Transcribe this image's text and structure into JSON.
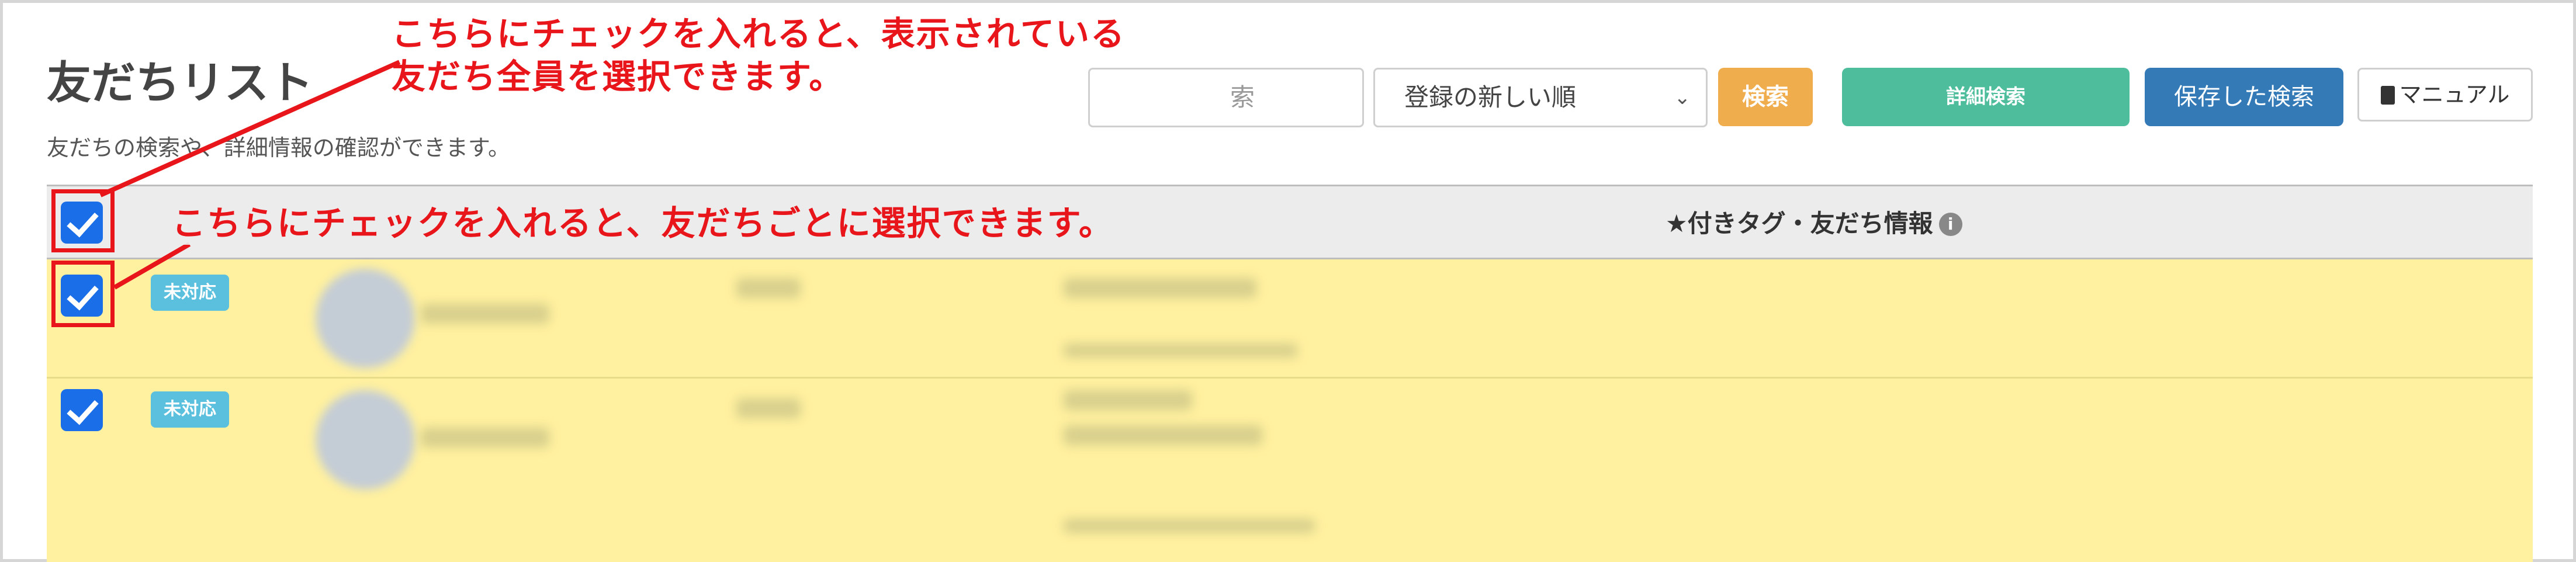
{
  "page": {
    "title": "友だちリスト",
    "description": "友だちの検索や、詳細情報の確認ができます。"
  },
  "toolbar": {
    "search_placeholder": "索",
    "sort_selected": "登録の新しい順",
    "search_label": "検索",
    "detail_search_label": "詳細検索",
    "saved_search_label": "保存した検索",
    "manual_label": "マニュアル"
  },
  "table": {
    "header": "★付きタグ・友だち情報",
    "rows": [
      {
        "checked": true,
        "status": "未対応"
      },
      {
        "checked": true,
        "status": "未対応"
      }
    ]
  },
  "annotations": {
    "select_all_line1": "こちらにチェックを入れると、表示されている",
    "select_all_line2": "友だち全員を選択できます。",
    "select_each": "こちらにチェックを入れると、友だちごとに選択できます。"
  },
  "colors": {
    "annotation": "#e8151b",
    "checkbox": "#1a6fe8",
    "row_highlight": "#fff19f",
    "badge": "#5bc0de",
    "search_button": "#f0ad4e",
    "detail_button": "#4dbd9c",
    "saved_button": "#337ab7"
  }
}
